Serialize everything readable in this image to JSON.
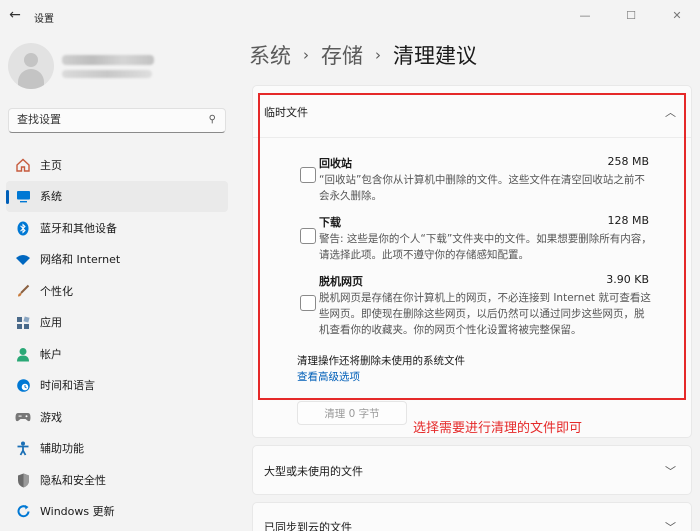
{
  "window": {
    "back": "←",
    "title": "设置",
    "controls": [
      "—",
      "☐",
      "✕"
    ]
  },
  "search": {
    "placeholder": "查找设置",
    "icon": "search-icon"
  },
  "nav": [
    {
      "label": "主页",
      "icon": "home-icon",
      "color": "#c65a3c",
      "glyph": "⌂"
    },
    {
      "label": "系统",
      "icon": "monitor-icon",
      "color": "#0078d4",
      "glyph": "▬",
      "active": true
    },
    {
      "label": "蓝牙和其他设备",
      "icon": "bluetooth-icon",
      "color": "#0078d4",
      "glyph": "ᛒ"
    },
    {
      "label": "网络和 Internet",
      "icon": "wifi-icon",
      "color": "#0067c0",
      "glyph": "◠"
    },
    {
      "label": "个性化",
      "icon": "brush-icon",
      "color": "#c87a3a",
      "glyph": "✎"
    },
    {
      "label": "应用",
      "icon": "apps-icon",
      "color": "#4a6a8a",
      "glyph": "▦"
    },
    {
      "label": "帐户",
      "icon": "account-icon",
      "color": "#2aa876",
      "glyph": "●"
    },
    {
      "label": "时间和语言",
      "icon": "globe-clock-icon",
      "color": "#0078d4",
      "glyph": "◔"
    },
    {
      "label": "游戏",
      "icon": "gamepad-icon",
      "color": "#777777",
      "glyph": "◉"
    },
    {
      "label": "辅助功能",
      "icon": "accessibility-icon",
      "color": "#1a6fb5",
      "glyph": "✦"
    },
    {
      "label": "隐私和安全性",
      "icon": "shield-icon",
      "color": "#6b6b6b",
      "glyph": "⛨"
    },
    {
      "label": "Windows 更新",
      "icon": "windows-update-icon",
      "color": "#0078d4",
      "glyph": "↻"
    }
  ],
  "breadcrumb": {
    "part1": "系统",
    "sep": "›",
    "part2": "存储",
    "part3": "清理建议"
  },
  "temp_card": {
    "title": "临时文件",
    "chevron": "︿",
    "items": [
      {
        "title": "回收站",
        "size": "258 MB",
        "desc": "“回收站”包含你从计算机中删除的文件。这些文件在清空回收站之前不会永久删除。"
      },
      {
        "title": "下载",
        "size": "128 MB",
        "desc": "警告: 这些是你的个人“下载”文件夹中的文件。如果想要删除所有内容，请选择此项。此项不遵守你的存储感知配置。"
      },
      {
        "title": "脱机网页",
        "size": "3.90 KB",
        "desc": "脱机网页是存储在你计算机上的网页，不必连接到 Internet 就可查看这些网页。即使现在删除这些网页，以后仍然可以通过同步这些网页，脱机查看你的收藏夹。你的网页个性化设置将被完整保留。"
      }
    ],
    "note": "清理操作还将删除未使用的系统文件",
    "advanced_link": "查看高级选项",
    "clean_button": "清理 0 字节"
  },
  "annotation": "选择需要进行清理的文件即可",
  "large_card": {
    "title": "大型或未使用的文件",
    "chevron": "﹀"
  },
  "cloud_card": {
    "title": "已同步到云的文件",
    "chevron": "﹀"
  },
  "colors": {
    "accent": "#005fb8",
    "annotation_red": "#e52929"
  }
}
